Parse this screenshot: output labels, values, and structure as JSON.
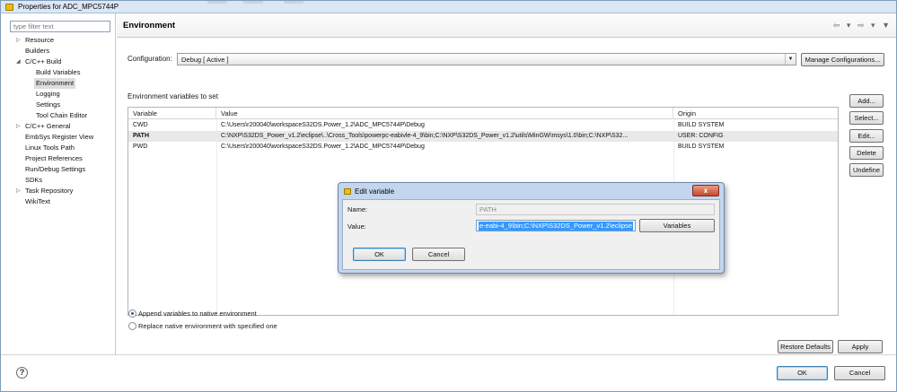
{
  "window": {
    "title": "Properties for ADC_MPC5744P"
  },
  "filter": {
    "placeholder": "type filter text"
  },
  "tree": [
    {
      "label": "Resource",
      "expandable": true,
      "expanded": false
    },
    {
      "label": "Builders"
    },
    {
      "label": "C/C++ Build",
      "expandable": true,
      "expanded": true
    },
    {
      "label": "Build Variables"
    },
    {
      "label": "Environment",
      "selected": true
    },
    {
      "label": "Logging"
    },
    {
      "label": "Settings"
    },
    {
      "label": "Tool Chain Editor"
    },
    {
      "label": "C/C++ General",
      "expandable": true,
      "expanded": false
    },
    {
      "label": "EmbSys Register View"
    },
    {
      "label": "Linux Tools Path"
    },
    {
      "label": "Project References"
    },
    {
      "label": "Run/Debug Settings"
    },
    {
      "label": "SDKs"
    },
    {
      "label": "Task Repository",
      "expandable": true,
      "expanded": false
    },
    {
      "label": "WikiText"
    }
  ],
  "page": {
    "title": "Environment"
  },
  "config": {
    "label": "Configuration:",
    "value": "Debug  [ Active ]",
    "manage_label": "Manage Configurations..."
  },
  "env": {
    "section_label": "Environment variables to set",
    "columns": [
      "Variable",
      "Value",
      "Origin"
    ],
    "rows": [
      {
        "variable": "CWD",
        "value": "C:\\Users\\r200040\\workspaceS32DS.Power_1.2\\ADC_MPC5744P\\Debug",
        "origin": "BUILD SYSTEM"
      },
      {
        "variable": "PATH",
        "value": "C:\\NXP\\S32DS_Power_v1.2\\eclipse\\..\\Cross_Tools\\powerpc-eabivle-4_9\\bin;C:\\NXP\\S32DS_Power_v1.2\\utils\\MinGW\\msys\\1.0\\bin;C:\\NXP\\S32...",
        "origin": "USER: CONFIG"
      },
      {
        "variable": "PWD",
        "value": "C:\\Users\\r200040\\workspaceS32DS.Power_1.2\\ADC_MPC5744P\\Debug",
        "origin": "BUILD SYSTEM"
      }
    ]
  },
  "side_buttons": {
    "add": "Add...",
    "select": "Select...",
    "edit": "Edit...",
    "delete": "Delete",
    "undefine": "Undefine"
  },
  "options": {
    "append": {
      "label": "Append variables to native environment",
      "selected": true
    },
    "replace": {
      "label": "Replace native environment with specified one",
      "selected": false
    }
  },
  "page_buttons": {
    "restore": "Restore Defaults",
    "apply": "Apply"
  },
  "footer": {
    "ok": "OK",
    "cancel": "Cancel",
    "help": "?"
  },
  "dialog": {
    "title": "Edit variable",
    "close": "x",
    "name_label": "Name:",
    "name_value": "PATH",
    "value_label": "Value:",
    "value_text": "e-eabi-4_9\\bin;C:\\NXP\\S32DS_Power_v1.2\\eclipse",
    "variables_label": "Variables",
    "ok": "OK",
    "cancel": "Cancel"
  }
}
